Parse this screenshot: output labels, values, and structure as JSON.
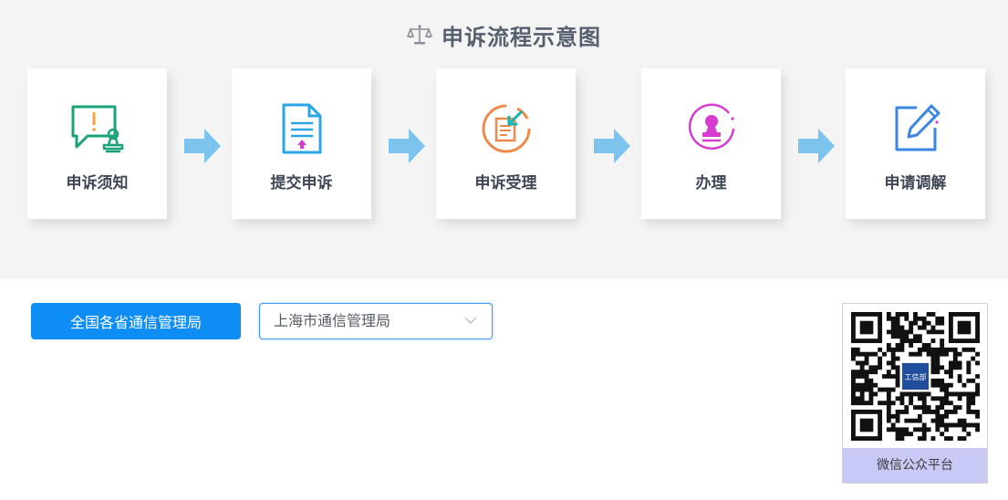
{
  "header": {
    "title": "申诉流程示意图",
    "icon": "scales-icon"
  },
  "steps": [
    {
      "label": "申诉须知",
      "icon": "notice-chat-icon",
      "color": "#1aa37b"
    },
    {
      "label": "提交申诉",
      "icon": "document-upload-icon",
      "color": "#2aa5e8"
    },
    {
      "label": "申诉受理",
      "icon": "accept-document-icon",
      "color": "#f08a4b"
    },
    {
      "label": "办理",
      "icon": "stamp-icon",
      "color": "#d63ccf"
    },
    {
      "label": "申请调解",
      "icon": "edit-icon",
      "color": "#3b86e2"
    }
  ],
  "controls": {
    "nationwide_button": "全国各省通信管理局",
    "region_select_value": "上海市通信管理局"
  },
  "qr": {
    "caption": "微信公众平台",
    "logo_text": "工信部"
  },
  "colors": {
    "top_bg": "#f4f4f4",
    "primary": "#0e8ef5",
    "arrow": "#7cc3ee"
  }
}
